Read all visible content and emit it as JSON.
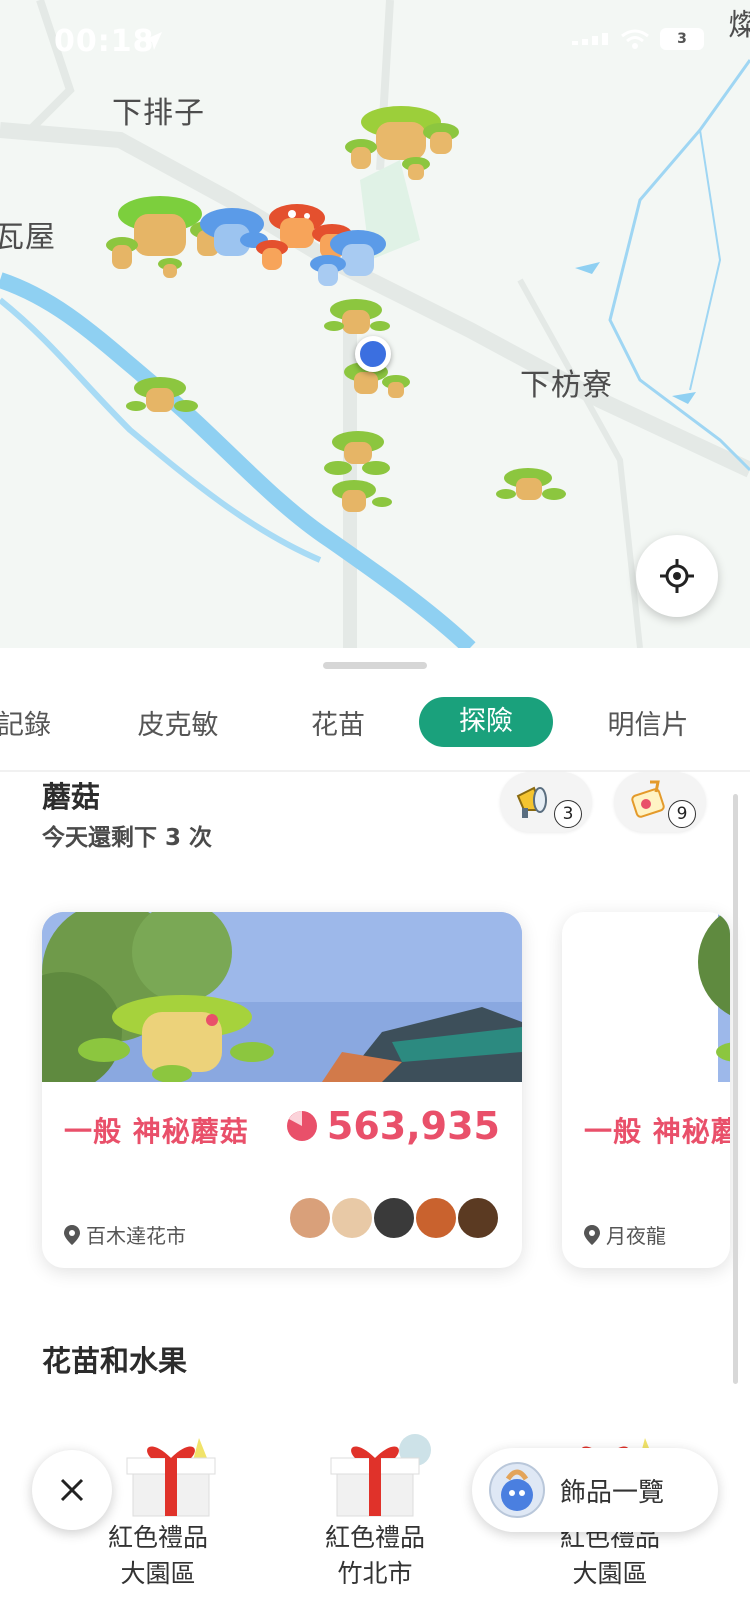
{
  "status_bar": {
    "time": "00:18",
    "battery": "3"
  },
  "map": {
    "places": [
      {
        "id": "xiapaizi",
        "label": "下排子"
      },
      {
        "id": "waw",
        "label": "瓦屋"
      },
      {
        "id": "xiafangliao",
        "label": "下枋寮"
      },
      {
        "id": "corner",
        "label": "燦"
      }
    ]
  },
  "tabs": [
    {
      "label": "記錄",
      "active": false
    },
    {
      "label": "皮克敏",
      "active": false
    },
    {
      "label": "花苗",
      "active": false
    },
    {
      "label": "探險",
      "active": true
    },
    {
      "label": "明信片",
      "active": false
    }
  ],
  "mushroom_section": {
    "title": "蘑菇",
    "subtitle": "今天還剩下 3 次",
    "chips": [
      {
        "icon": "megaphone-icon",
        "count": "3"
      },
      {
        "icon": "ticket-icon",
        "count": "9"
      }
    ],
    "cards": [
      {
        "title": "一般 神秘蘑菇",
        "points": "563,935",
        "location": "百木達花市"
      },
      {
        "title": "一般 神秘蘑菇",
        "location": "月夜龍"
      }
    ]
  },
  "flowers_section": {
    "title": "花苗和水果",
    "items": [
      {
        "name": "紅色禮品",
        "sub": "大園區"
      },
      {
        "name": "紅色禮品",
        "sub": "竹北市"
      },
      {
        "name": "紅色禮品",
        "sub": "大園區"
      }
    ]
  },
  "bottom": {
    "decor_label": "飾品一覽"
  },
  "colors": {
    "accent": "#1aa17c",
    "mushroom_red": "#e9506a",
    "river": "#8fd0f2"
  }
}
